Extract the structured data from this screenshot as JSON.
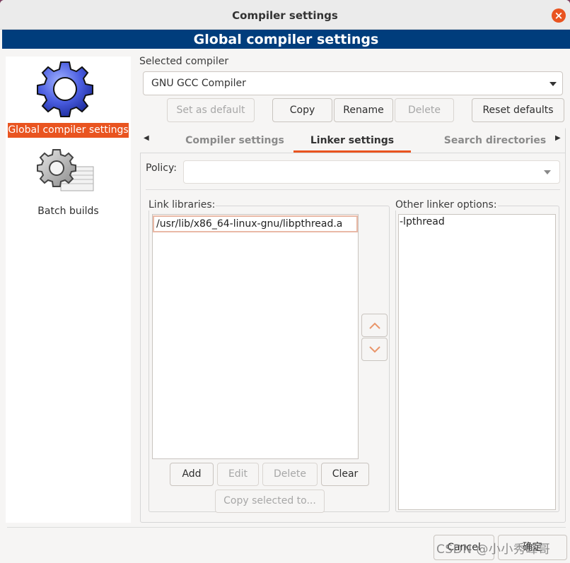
{
  "window": {
    "title": "Compiler settings",
    "close_symbol": "×"
  },
  "banner": "Global compiler settings",
  "sidebar": {
    "items": [
      {
        "label": "Global compiler settings",
        "icon": "gear-icon",
        "selected": true
      },
      {
        "label": "Batch builds",
        "icon": "batch-gear-icon",
        "selected": false
      }
    ]
  },
  "compiler": {
    "group_title": "Selected compiler",
    "selected": "GNU GCC Compiler",
    "buttons": {
      "set_default": "Set as default",
      "copy": "Copy",
      "rename": "Rename",
      "delete": "Delete",
      "reset": "Reset defaults"
    }
  },
  "tabs": {
    "items": [
      "Compiler settings",
      "Linker settings",
      "Search directories"
    ],
    "active": "Linker settings",
    "left_arrow": "◀",
    "right_arrow": "▶"
  },
  "linker": {
    "policy_label": "Policy:",
    "policy_value": "",
    "link_libraries_title": "Link libraries:",
    "libraries": [
      "/usr/lib/x86_64-linux-gnu/libpthread.a"
    ],
    "other_options_title": "Other linker options:",
    "other_options": "-lpthread",
    "buttons": {
      "add": "Add",
      "edit": "Edit",
      "delete": "Delete",
      "clear": "Clear",
      "copy_selected": "Copy selected to..."
    },
    "move_up": "︿",
    "move_down": "﹀"
  },
  "footer": {
    "cancel": "Cancel",
    "ok": "确定"
  },
  "watermark": "CSDN @小小秀峰哥",
  "colors": {
    "accent": "#e95420",
    "banner": "#003d7c"
  }
}
